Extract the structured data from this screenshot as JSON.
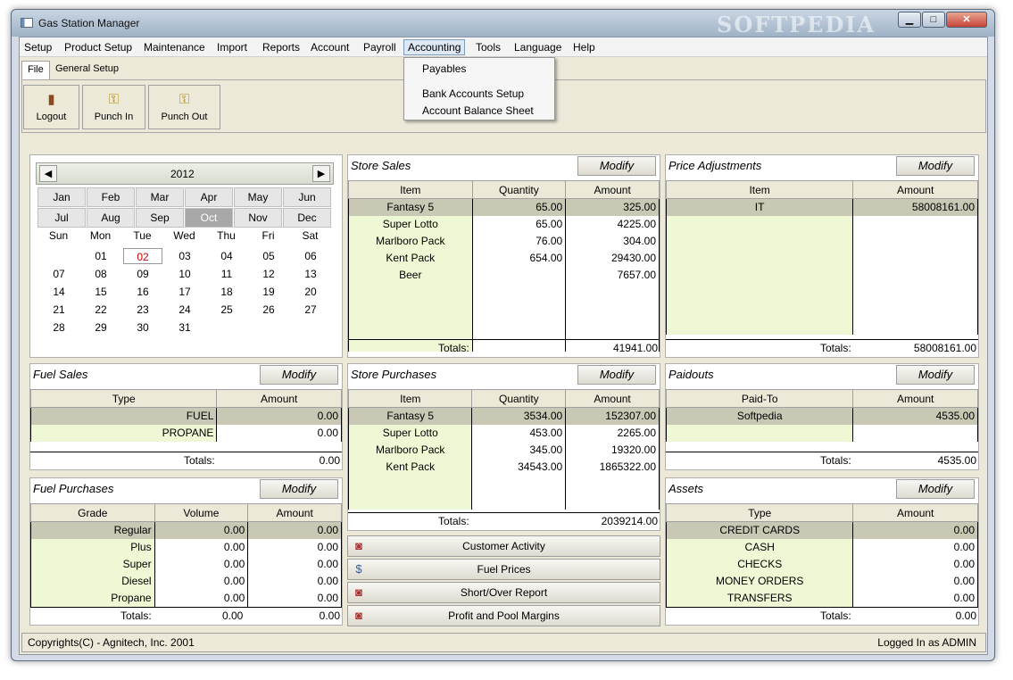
{
  "window": {
    "title": "Gas Station Manager",
    "watermark": "SOFTPEDIA",
    "min": "▁",
    "max": "□",
    "close": "✕"
  },
  "menubar": [
    "Setup",
    "Product Setup",
    "Maintenance",
    "Import",
    "Reports",
    "Account",
    "Payroll",
    "Accounting",
    "Tools",
    "Language",
    "Help"
  ],
  "accounting_menu": [
    "Payables",
    "Bank Accounts Setup",
    "Account Balance Sheet"
  ],
  "tabs": [
    "File",
    "General Setup"
  ],
  "toolbar": {
    "logout": "Logout",
    "punch_in": "Punch In",
    "punch_out": "Punch Out"
  },
  "calendar": {
    "year": "2012",
    "prev": "◀",
    "next": "▶",
    "months": [
      "Jan",
      "Feb",
      "Mar",
      "Apr",
      "May",
      "Jun",
      "Jul",
      "Aug",
      "Sep",
      "Oct",
      "Nov",
      "Dec"
    ],
    "selected_month": "Oct",
    "weekdays": [
      "Sun",
      "Mon",
      "Tue",
      "Wed",
      "Thu",
      "Fri",
      "Sat"
    ],
    "days": [
      "01",
      "02",
      "03",
      "04",
      "05",
      "06",
      "07",
      "08",
      "09",
      "10",
      "11",
      "12",
      "13",
      "14",
      "15",
      "16",
      "17",
      "18",
      "19",
      "20",
      "21",
      "22",
      "23",
      "24",
      "25",
      "26",
      "27",
      "28",
      "29",
      "30",
      "31"
    ],
    "first_weekday": 1,
    "today": "02"
  },
  "modify_label": "Modify",
  "totals_label": "Totals:",
  "store_sales": {
    "title": "Store Sales",
    "headers": [
      "Item",
      "Quantity",
      "Amount"
    ],
    "rows": [
      [
        "Fantasy 5",
        "65.00",
        "325.00"
      ],
      [
        "Super Lotto",
        "65.00",
        "4225.00"
      ],
      [
        "Marlboro Pack",
        "76.00",
        "304.00"
      ],
      [
        "Kent Pack",
        "654.00",
        "29430.00"
      ],
      [
        "Beer",
        "",
        "7657.00"
      ]
    ],
    "total": "41941.00"
  },
  "price_adjustments": {
    "title": "Price Adjustments",
    "headers": [
      "Item",
      "Amount"
    ],
    "rows": [
      [
        "IT",
        "58008161.00"
      ]
    ],
    "total": "58008161.00"
  },
  "fuel_sales": {
    "title": "Fuel Sales",
    "headers": [
      "Type",
      "Amount"
    ],
    "rows": [
      [
        "FUEL",
        "0.00"
      ],
      [
        "PROPANE",
        "0.00"
      ]
    ],
    "total": "0.00"
  },
  "store_purchases": {
    "title": "Store Purchases",
    "headers": [
      "Item",
      "Quantity",
      "Amount"
    ],
    "rows": [
      [
        "Fantasy 5",
        "3534.00",
        "152307.00"
      ],
      [
        "Super Lotto",
        "453.00",
        "2265.00"
      ],
      [
        "Marlboro Pack",
        "345.00",
        "19320.00"
      ],
      [
        "Kent Pack",
        "34543.00",
        "1865322.00"
      ]
    ],
    "total": "2039214.00"
  },
  "paidouts": {
    "title": "Paidouts",
    "headers": [
      "Paid-To",
      "Amount"
    ],
    "rows": [
      [
        "Softpedia",
        "4535.00"
      ]
    ],
    "total": "4535.00"
  },
  "fuel_purchases": {
    "title": "Fuel Purchases",
    "headers": [
      "Grade",
      "Volume",
      "Amount"
    ],
    "rows": [
      [
        "Regular",
        "0.00",
        "0.00"
      ],
      [
        "Plus",
        "0.00",
        "0.00"
      ],
      [
        "Super",
        "0.00",
        "0.00"
      ],
      [
        "Diesel",
        "0.00",
        "0.00"
      ],
      [
        "Propane",
        "0.00",
        "0.00"
      ]
    ],
    "total_volume": "0.00",
    "total": "0.00"
  },
  "assets": {
    "title": "Assets",
    "headers": [
      "Type",
      "Amount"
    ],
    "rows": [
      [
        "CREDIT CARDS",
        "0.00"
      ],
      [
        "CASH",
        "0.00"
      ],
      [
        "CHECKS",
        "0.00"
      ],
      [
        "MONEY ORDERS",
        "0.00"
      ],
      [
        "TRANSFERS",
        "0.00"
      ]
    ],
    "total": "0.00"
  },
  "actions": [
    "Customer Activity",
    "Fuel Prices",
    "Short/Over Report",
    "Profit and Pool Margins"
  ],
  "status": {
    "copyright": "Copyrights(C) - Agnitech, Inc. 2001",
    "login": "Logged In as ADMIN"
  }
}
